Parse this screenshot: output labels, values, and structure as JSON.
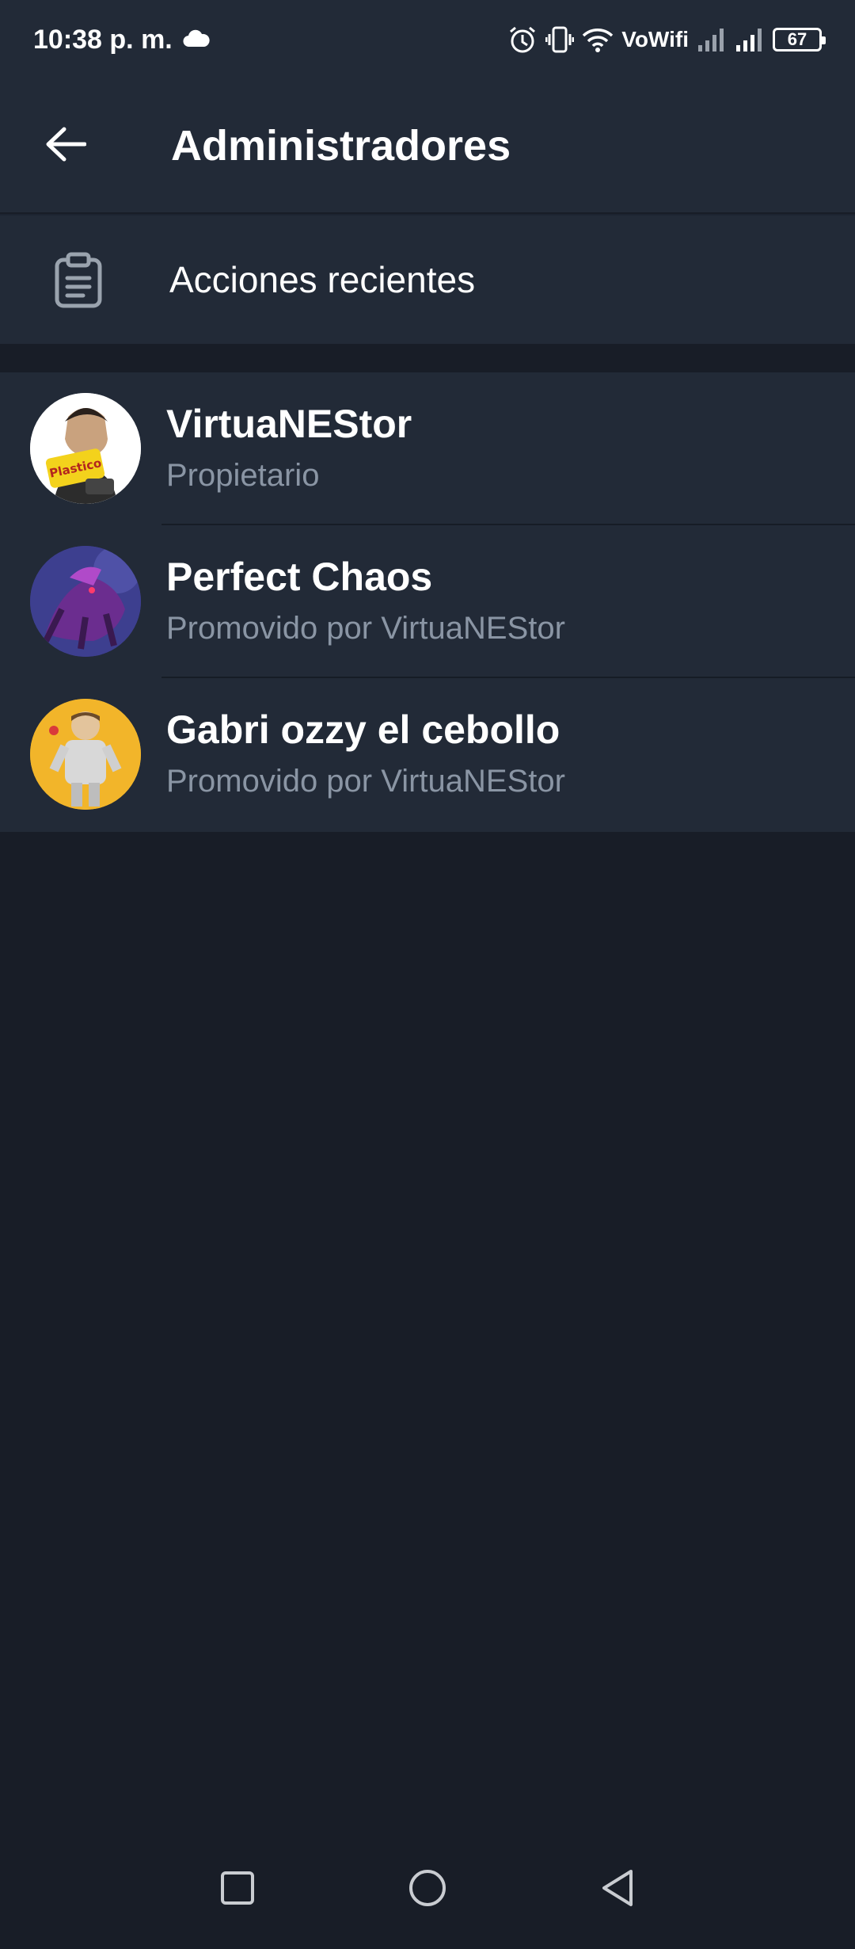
{
  "status_bar": {
    "time": "10:38 p. m.",
    "network_label": "VoWifi",
    "battery": "67",
    "icons": [
      "cloud-icon",
      "alarm-icon",
      "vibrate-icon",
      "wifi-icon",
      "signal-icon",
      "signal-icon",
      "battery-icon"
    ]
  },
  "app_bar": {
    "title": "Administradores",
    "back_icon": "arrow-left-icon"
  },
  "recent_actions": {
    "label": "Acciones recientes",
    "icon": "clipboard-icon"
  },
  "admins": [
    {
      "name": "VirtuaNEStor",
      "role": "Propietario",
      "avatar_bg": "#ffffff"
    },
    {
      "name": "Perfect Chaos",
      "role": "Promovido por VirtuaNEStor",
      "avatar_bg": "#3d3f8f"
    },
    {
      "name": "Gabri ozzy el cebollo",
      "role": "Promovido por VirtuaNEStor",
      "avatar_bg": "#f2b52a"
    }
  ],
  "nav_bar": {
    "items": [
      "recents-square-icon",
      "home-circle-icon",
      "back-triangle-icon"
    ]
  },
  "colors": {
    "background": "#181d27",
    "surface": "#222a37",
    "secondary_text": "#8a95a4"
  }
}
